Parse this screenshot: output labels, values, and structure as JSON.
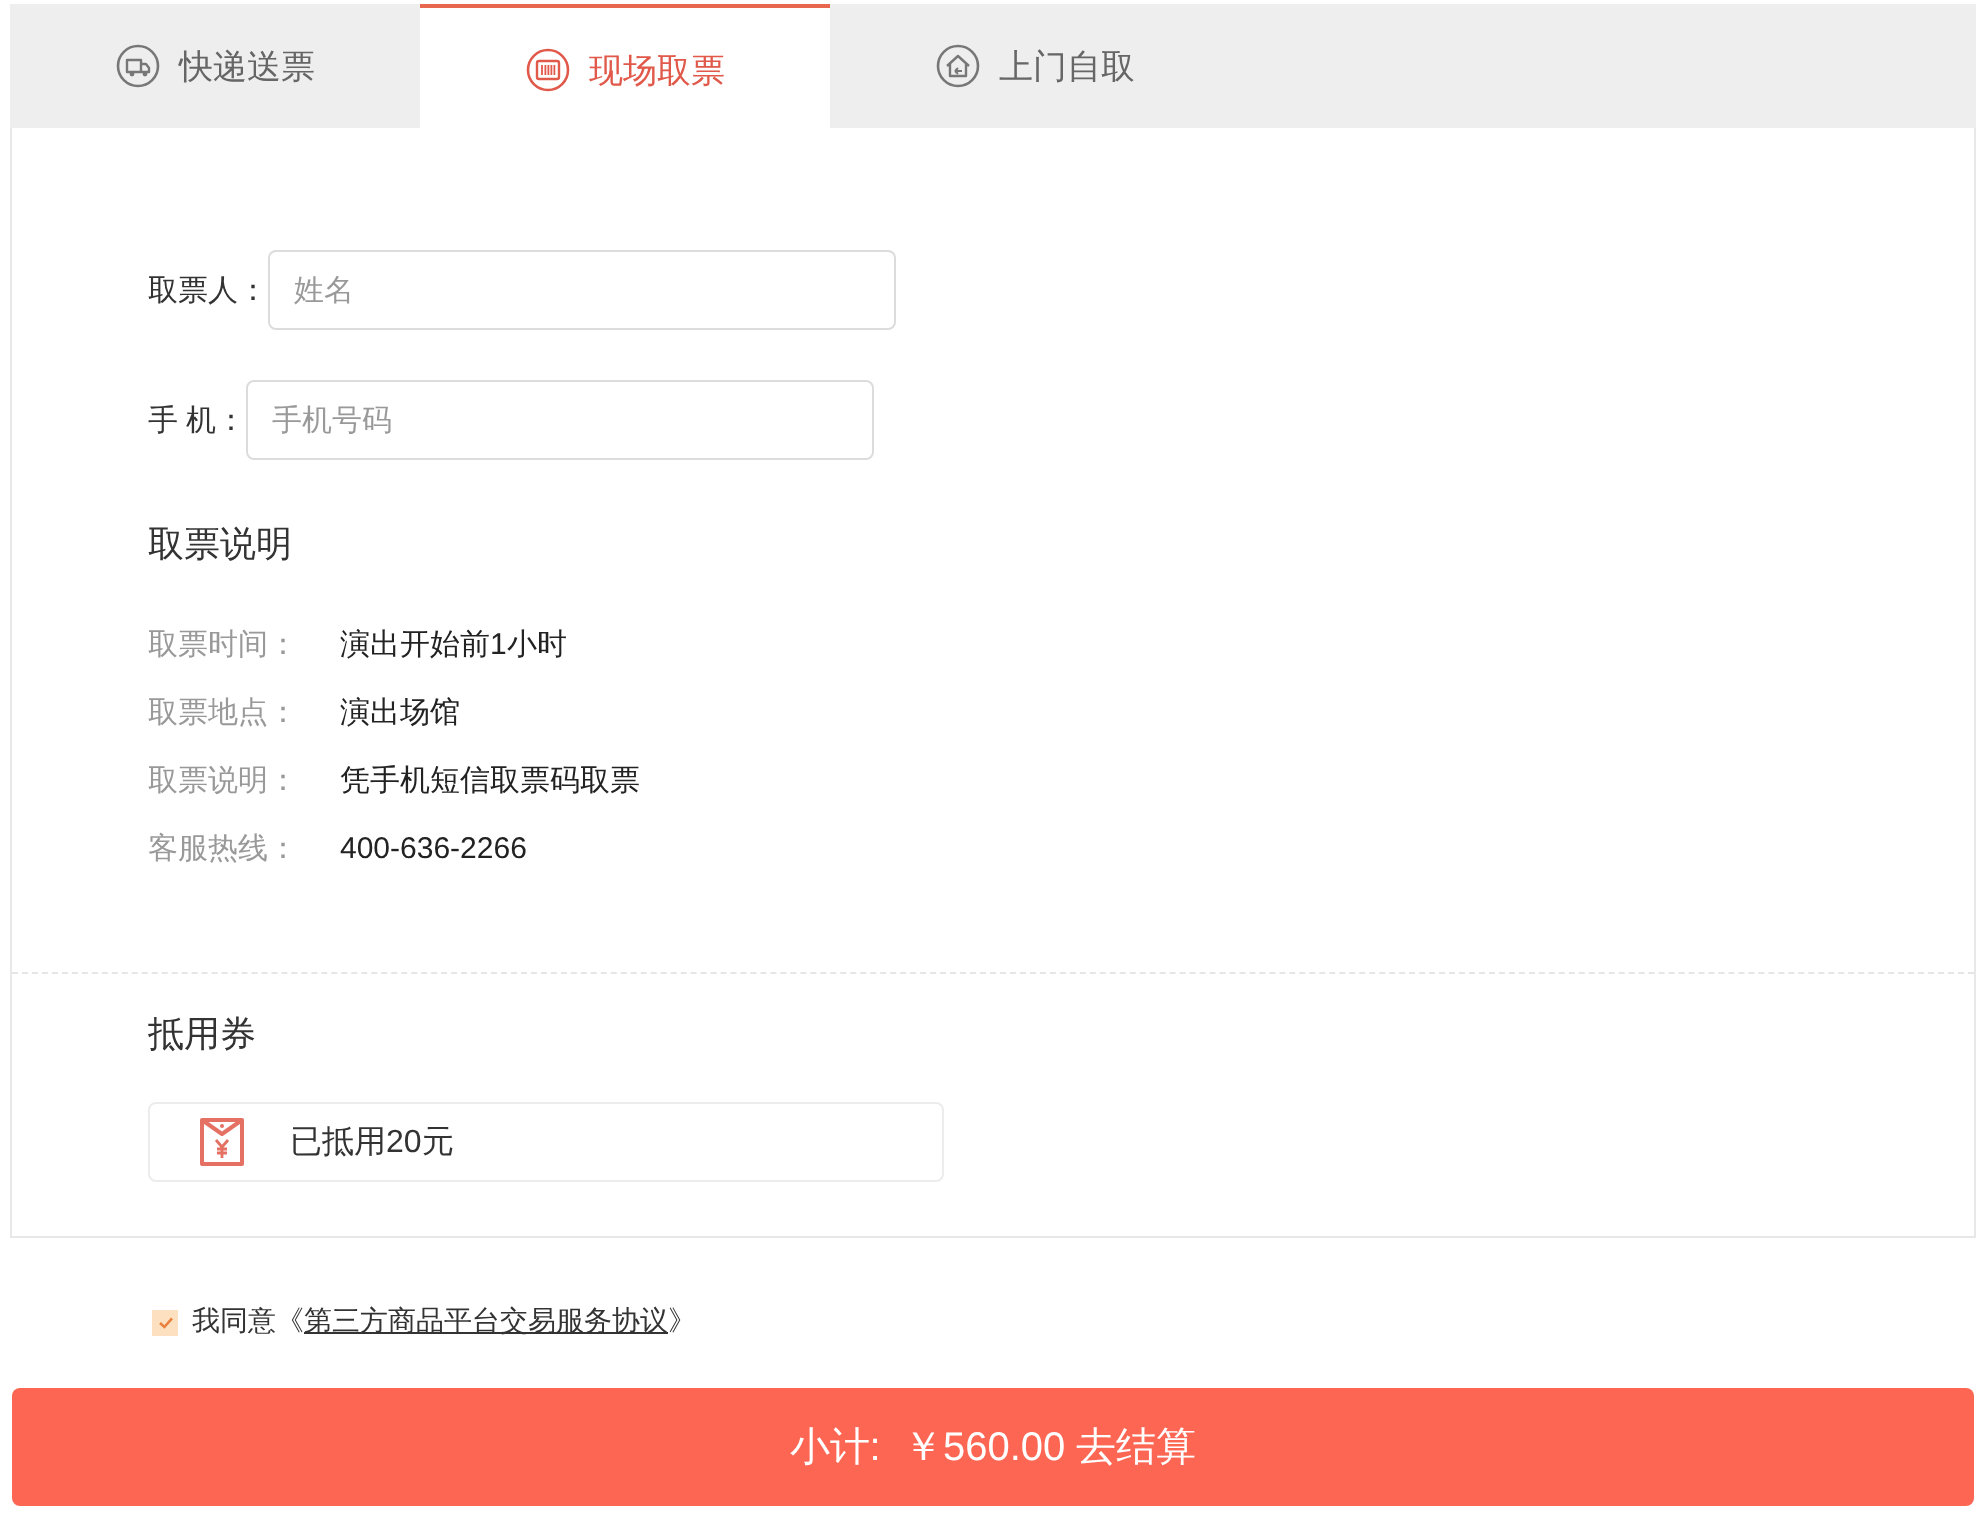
{
  "tabs": [
    {
      "label": "快递送票",
      "selected": false
    },
    {
      "label": "现场取票",
      "selected": true
    },
    {
      "label": "上门自取",
      "selected": false
    }
  ],
  "form": {
    "fields": [
      {
        "label": "取票人：",
        "placeholder": "姓名"
      },
      {
        "label": "手 机：",
        "placeholder": "手机号码"
      }
    ]
  },
  "pickup_info": {
    "title": "取票说明",
    "rows": [
      {
        "label": "取票时间：",
        "value": "演出开始前1小时"
      },
      {
        "label": "取票地点：",
        "value": "演出场馆"
      },
      {
        "label": "取票说明：",
        "value": "凭手机短信取票码取票"
      },
      {
        "label": "客服热线：",
        "value": "400-636-2266"
      }
    ]
  },
  "coupon": {
    "title": "抵用券",
    "text": "已抵用20元"
  },
  "agreement": {
    "checked": true,
    "prefix": "我同意《",
    "link": "第三方商品平台交易服务协议",
    "suffix": "》"
  },
  "checkout_button": {
    "label": "小计:  ￥560.00 去结算"
  }
}
